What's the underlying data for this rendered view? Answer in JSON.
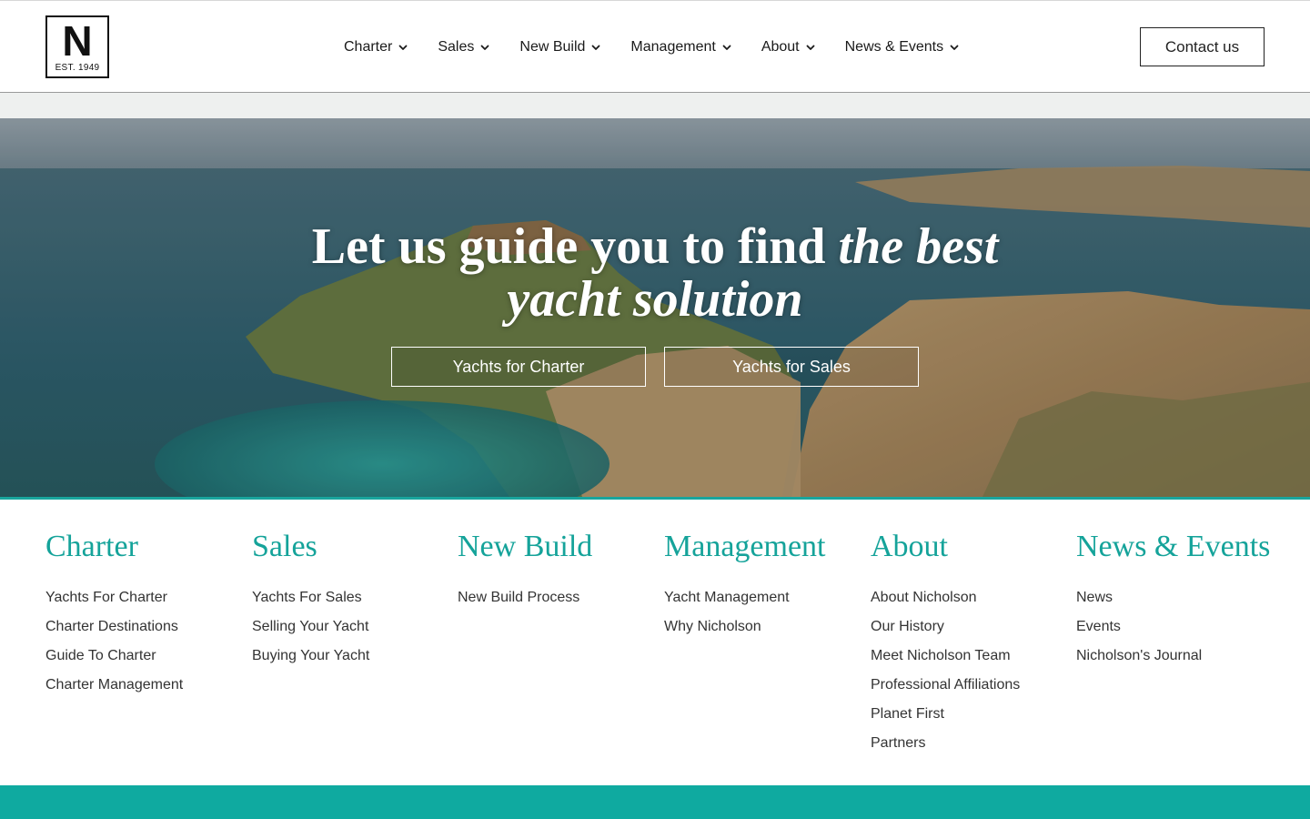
{
  "brand": {
    "logo_letter": "N",
    "logo_est": "EST. 1949"
  },
  "nav": {
    "items": [
      {
        "label": "Charter"
      },
      {
        "label": "Sales"
      },
      {
        "label": "New Build"
      },
      {
        "label": "Management"
      },
      {
        "label": "About"
      },
      {
        "label": "News & Events"
      }
    ],
    "contact_label": "Contact us"
  },
  "hero": {
    "title_plain": "Let us guide you to find ",
    "title_italic_1": "the best",
    "title_italic_2": "yacht solution",
    "buttons": {
      "charter": "Yachts for Charter",
      "sales": "Yachts for Sales"
    }
  },
  "footer_menu": {
    "columns": [
      {
        "heading": "Charter",
        "links": [
          "Yachts For Charter",
          "Charter Destinations",
          "Guide To Charter",
          "Charter Management"
        ]
      },
      {
        "heading": "Sales",
        "links": [
          "Yachts For Sales",
          "Selling Your Yacht",
          "Buying Your Yacht"
        ]
      },
      {
        "heading": "New Build",
        "links": [
          "New Build Process"
        ]
      },
      {
        "heading": "Management",
        "links": [
          "Yacht Management",
          "Why Nicholson"
        ]
      },
      {
        "heading": "About",
        "links": [
          "About Nicholson",
          "Our History",
          "Meet Nicholson Team",
          "Professional Affiliations",
          "Planet First",
          "Partners"
        ]
      },
      {
        "heading": "News & Events",
        "links": [
          "News",
          "Events",
          "Nicholson's Journal"
        ]
      }
    ]
  },
  "colors": {
    "accent": "#15a39a",
    "footer_bar": "#0faaa0",
    "band": "#eef0ef"
  },
  "icons": {
    "nav_dropdown": "chevron-down-icon"
  }
}
